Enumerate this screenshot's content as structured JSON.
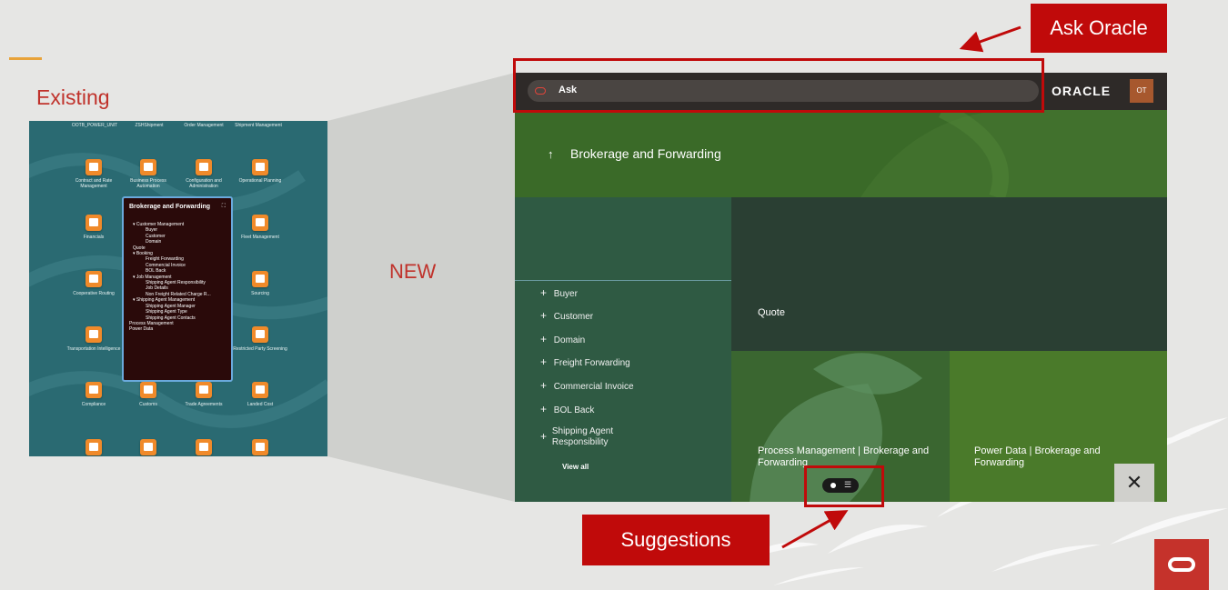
{
  "slide": {
    "existing_heading": "Existing",
    "new_heading": "NEW",
    "callout_ask": "Ask Oracle",
    "callout_suggestions": "Suggestions",
    "accent_color": "#e8a33a",
    "callout_color": "#c00a0a"
  },
  "existing": {
    "top_labels": [
      "OOTB_POWER_UNIT",
      "ZSHShipment",
      "Order Management",
      "Shipment Management"
    ],
    "tiles": [
      "Contract and Rate Management",
      "Business Process Automation",
      "Configuration and Administration",
      "Operational Planning",
      "Financials",
      "Fleet Management",
      "Cooperative Routing",
      "Sourcing",
      "Transportation Intelligence",
      "Restricted Party Screening",
      "Compliance",
      "Customs",
      "Trade Agreements",
      "Landed Cost"
    ],
    "panel": {
      "title": "Brokerage and Forwarding",
      "expand_icon": "expand-icon",
      "items": [
        {
          "level": 1,
          "text": "▾ Customer Management"
        },
        {
          "level": 2,
          "text": "Buyer"
        },
        {
          "level": 2,
          "text": "Customer"
        },
        {
          "level": 2,
          "text": "Domain"
        },
        {
          "level": 1,
          "text": "Quote"
        },
        {
          "level": 1,
          "text": "▾ Booking"
        },
        {
          "level": 2,
          "text": "Freight Forwarding"
        },
        {
          "level": 2,
          "text": "Commercial Invoice"
        },
        {
          "level": 2,
          "text": "BOL Back"
        },
        {
          "level": 1,
          "text": "▾ Job Management"
        },
        {
          "level": 2,
          "text": "Shipping Agent Responsibility"
        },
        {
          "level": 2,
          "text": "Job Details"
        },
        {
          "level": 2,
          "text": "Non Freight Related Charge R..."
        },
        {
          "level": 1,
          "text": "▾ Shipping Agent Management"
        },
        {
          "level": 2,
          "text": "Shipping Agent Manager"
        },
        {
          "level": 2,
          "text": "Shipping Agent Type"
        },
        {
          "level": 2,
          "text": "Shipping Agent Contacts"
        },
        {
          "level": 0,
          "text": "Process Management"
        },
        {
          "level": 0,
          "text": "Power Data"
        }
      ]
    }
  },
  "new_ui": {
    "ask_placeholder": "Ask",
    "brand": "ORACLE",
    "avatar_initials": "OT",
    "banner_title": "Brokerage and Forwarding",
    "nav_items": [
      "Buyer",
      "Customer",
      "Domain",
      "Freight Forwarding",
      "Commercial Invoice",
      "BOL Back",
      "Shipping Agent Responsibility"
    ],
    "view_all": "View all",
    "tiles": {
      "quote": "Quote",
      "process_management": "Process Management | Brokerage and Forwarding",
      "power_data": "Power Data | Brokerage and Forwarding"
    },
    "close_symbol": "✕"
  }
}
